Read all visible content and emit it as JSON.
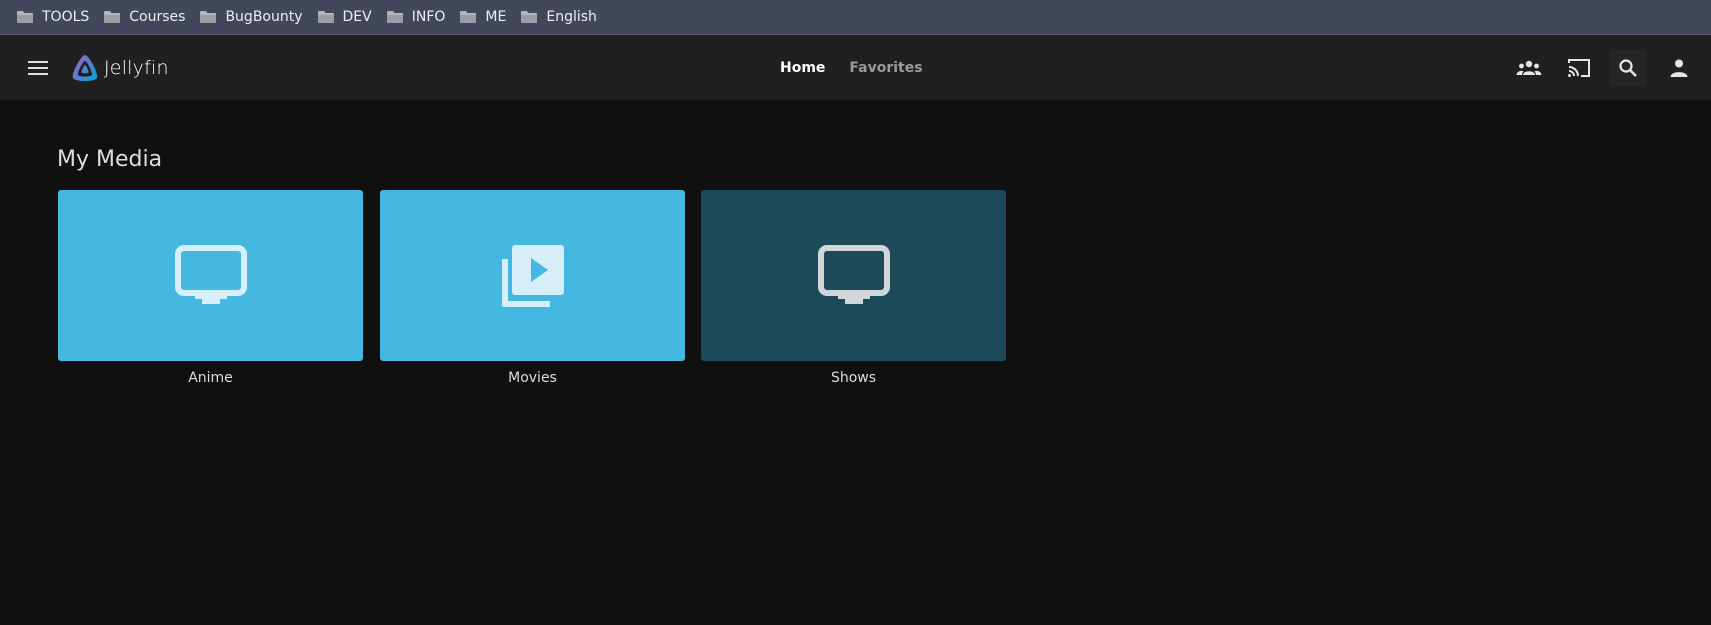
{
  "bookmarks": [
    {
      "label": "TOOLS"
    },
    {
      "label": "Courses"
    },
    {
      "label": "BugBounty"
    },
    {
      "label": "DEV"
    },
    {
      "label": "INFO"
    },
    {
      "label": "ME"
    },
    {
      "label": "English"
    }
  ],
  "header": {
    "app_name": "Jellyfin",
    "tabs": [
      {
        "label": "Home",
        "active": true
      },
      {
        "label": "Favorites",
        "active": false
      }
    ],
    "icons": [
      "group-icon",
      "cast-icon",
      "search-icon",
      "user-icon"
    ]
  },
  "main": {
    "section_title": "My Media",
    "libraries": [
      {
        "label": "Anime",
        "icon": "tv-icon",
        "color": "#44b8e0"
      },
      {
        "label": "Movies",
        "icon": "video-library-icon",
        "color": "#44b8e0"
      },
      {
        "label": "Shows",
        "icon": "tv-icon",
        "color": "#1c4a5b"
      }
    ]
  },
  "colors": {
    "bookmark_bar": "#43475c",
    "header": "#202020",
    "background": "#101010",
    "accent": "#44b8e0"
  }
}
